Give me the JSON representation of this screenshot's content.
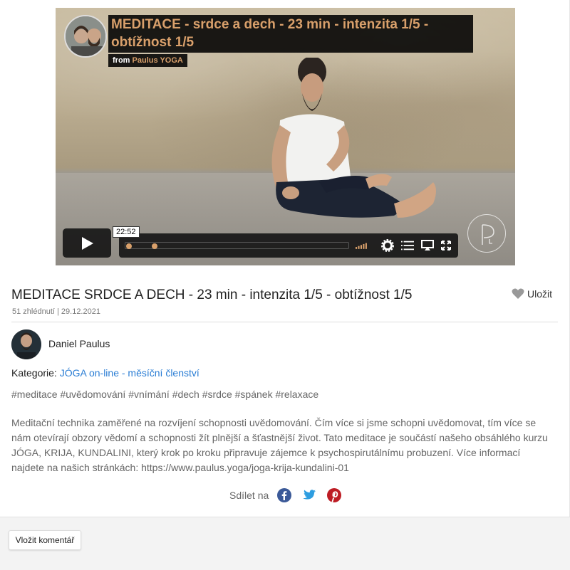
{
  "video": {
    "title": "MEDITACE - srdce a dech - 23 min - intenzita 1/5 - obtížnost 1/5",
    "from_label": "from",
    "from_owner": "Paulus YOGA",
    "time": "22:52",
    "progress_fraction": 0.12,
    "accent_color": "#d9a06b",
    "icons": [
      "play-icon",
      "volume-icon",
      "settings-icon",
      "chapters-icon",
      "airplay-icon",
      "fullscreen-icon"
    ]
  },
  "page": {
    "title": "MEDITACE SRDCE A DECH - 23 min - intenzita 1/5 - obtížnost 1/5",
    "save_label": "Uložit",
    "meta": "51 zhlédnutí | 29.12.2021",
    "author": "Daniel Paulus",
    "category_label": "Kategorie:",
    "category_value": "JÓGA on-line - měsíční členství",
    "tags": "#meditace #uvědomování #vnímání #dech #srdce #spánek #relaxace",
    "description": "Meditační technika zaměřené na rozvíjení schopnosti uvědomování. Čím více si jsme schopni uvědomovat, tím více se nám otevírají obzory vědomí a schopnosti žít plnější a šťastnější život. Tato meditace je součástí našeho obsáhlého kurzu JÓGA, KRIJA, KUNDALINI, který krok po kroku připravuje zájemce k psychospirutálnímu probuzení. Více informací najdete na našich stránkách: https://www.paulus.yoga/joga-krija-kundalini-01",
    "share_label": "Sdílet na",
    "comment_button": "Vložit komentář",
    "link_color": "#2a7dd4"
  }
}
